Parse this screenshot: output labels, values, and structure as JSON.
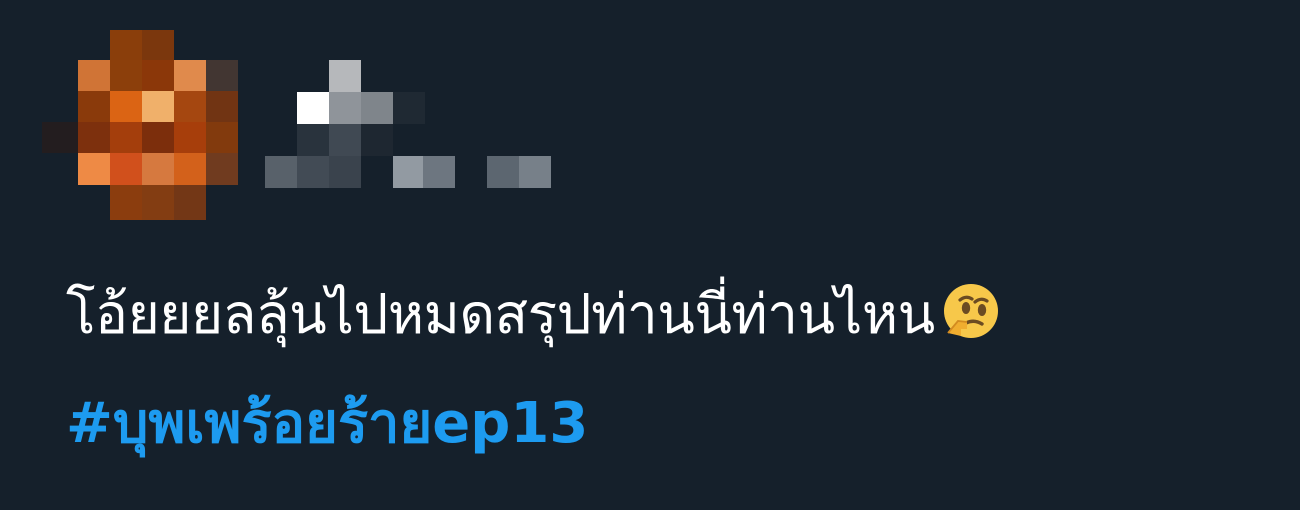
{
  "tweet": {
    "text": "โอ้ยยยลลุ้นไปหมดสรุปท่านนี่ท่านไหน",
    "emoji": "thinking-face",
    "hashtag": "#บุพเพร้อยร้ายep13"
  },
  "colors": {
    "background": "#15202b",
    "text": "#ffffff",
    "hashtag": "#1d9bf0"
  },
  "icons": {
    "avatar": "pixelated-avatar",
    "author": "pixelated-author-name"
  }
}
